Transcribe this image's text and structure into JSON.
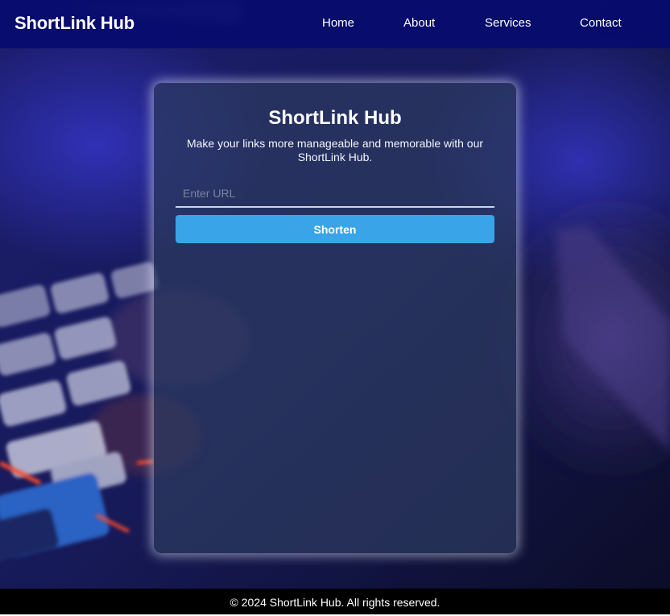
{
  "header": {
    "brand": "ShortLink Hub",
    "nav": [
      {
        "label": "Home"
      },
      {
        "label": "About"
      },
      {
        "label": "Services"
      },
      {
        "label": "Contact"
      }
    ]
  },
  "card": {
    "title": "ShortLink Hub",
    "subtitle": "Make your links more manageable and memorable with our ShortLink Hub.",
    "url_input": {
      "placeholder": "Enter URL",
      "value": ""
    },
    "shorten_label": "Shorten"
  },
  "footer": {
    "text": "© 2024 ShortLink Hub. All rights reserved."
  },
  "colors": {
    "navbar": "#060a6e",
    "accent": "#3aa4e8",
    "footer": "#000000"
  }
}
